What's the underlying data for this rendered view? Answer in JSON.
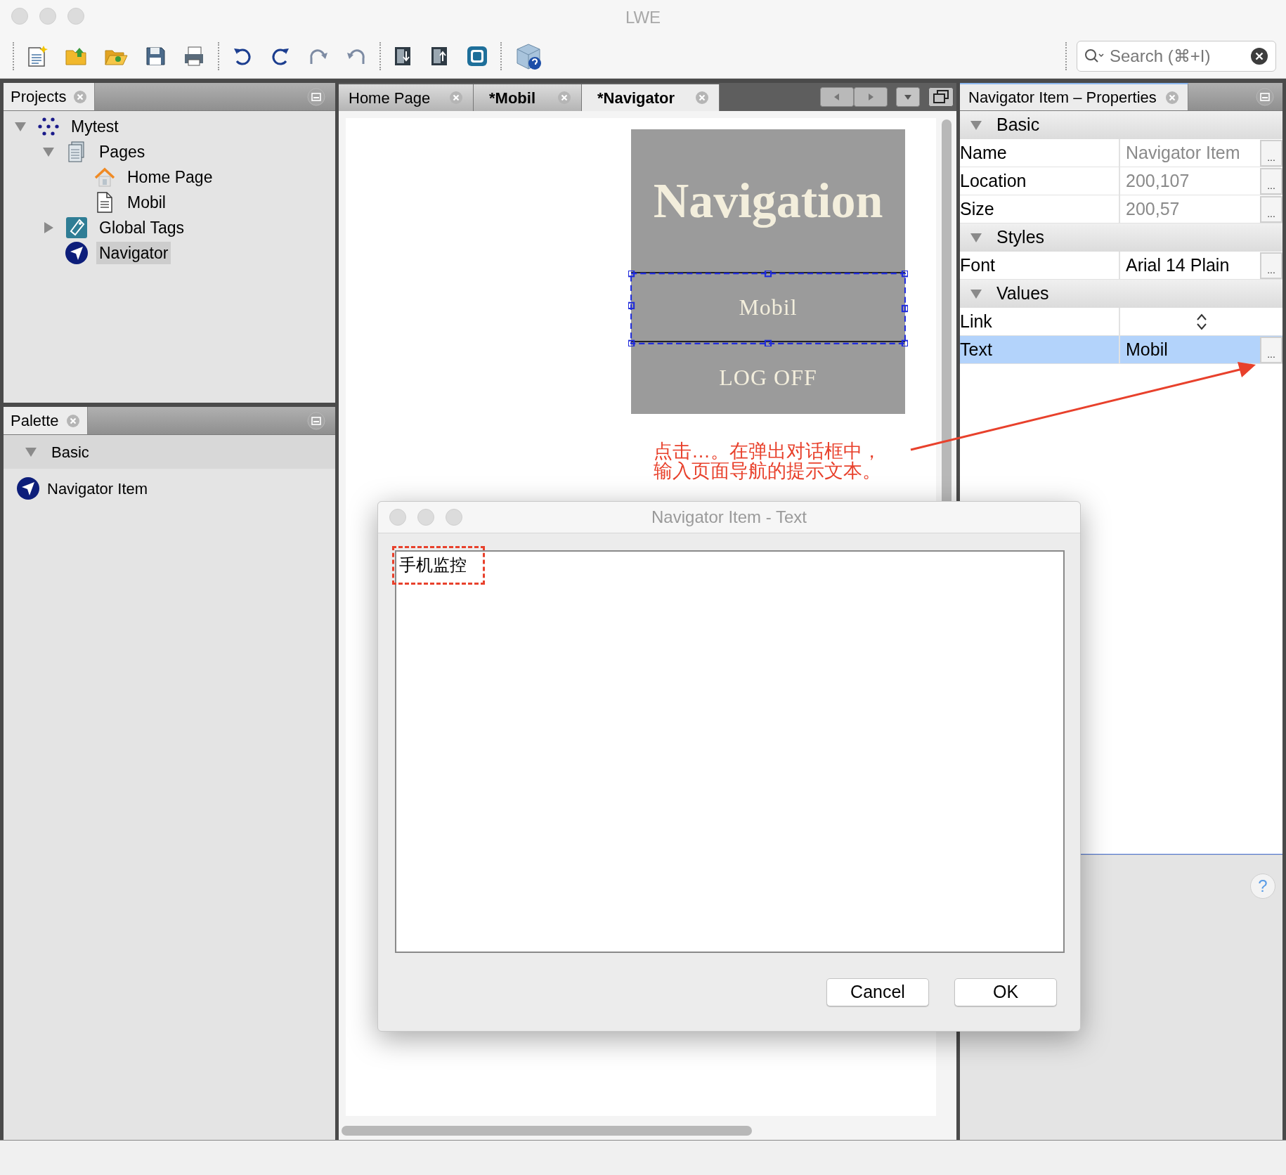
{
  "window": {
    "title": "LWE"
  },
  "toolbar": {
    "search": {
      "placeholder": "Search (⌘+I)"
    }
  },
  "projects_panel": {
    "title": "Projects",
    "tree": [
      {
        "label": "Mytest",
        "kind": "project",
        "expanded": true,
        "selected": false,
        "children": [
          {
            "label": "Pages",
            "kind": "pages",
            "expanded": true,
            "selected": false,
            "children": [
              {
                "label": "Home Page",
                "kind": "home",
                "selected": false
              },
              {
                "label": "Mobil",
                "kind": "page",
                "selected": false
              }
            ]
          },
          {
            "label": "Global Tags",
            "kind": "tags",
            "expanded": false,
            "selected": false
          },
          {
            "label": "Navigator",
            "kind": "navigator",
            "selected": true
          }
        ]
      }
    ]
  },
  "palette": {
    "title": "Palette",
    "groups": [
      {
        "label": "Basic",
        "expanded": true,
        "items": [
          {
            "label": "Navigator Item",
            "kind": "navigator"
          }
        ]
      }
    ]
  },
  "editor": {
    "tabs": [
      {
        "label": "Home Page",
        "selected": false,
        "modified": false
      },
      {
        "label": "*Mobil",
        "selected": false,
        "modified": true
      },
      {
        "label": "*Navigator",
        "selected": true,
        "modified": true
      }
    ],
    "navigator": {
      "title": "Navigation",
      "items": [
        {
          "label": "Mobil",
          "selected": true
        },
        {
          "label": "LOG OFF",
          "selected": false
        }
      ]
    }
  },
  "annotation": {
    "lines": [
      "点击…。在弹出对话框中，",
      "输入页面导航的提示文本。"
    ]
  },
  "properties": {
    "title": "Navigator Item – Properties",
    "sections": [
      {
        "label": "Basic",
        "expanded": true,
        "rows": [
          {
            "name": "Name",
            "value": "Navigator Item",
            "kind": "dialog",
            "button": "...",
            "disabled": true,
            "selected": false
          },
          {
            "name": "Location",
            "value": "200,107",
            "kind": "dialog",
            "button": "...",
            "disabled": true,
            "selected": false
          },
          {
            "name": "Size",
            "value": "200,57",
            "kind": "dialog",
            "button": "...",
            "disabled": true,
            "selected": false
          }
        ]
      },
      {
        "label": "Styles",
        "expanded": true,
        "rows": [
          {
            "name": "Font",
            "value": "Arial 14 Plain",
            "kind": "dialog",
            "button": "...",
            "disabled": false,
            "selected": false
          }
        ]
      },
      {
        "label": "Values",
        "expanded": true,
        "rows": [
          {
            "name": "Link",
            "kind": "choice",
            "selected": false
          },
          {
            "name": "Text",
            "value": "Mobil",
            "kind": "dialog",
            "button": "...",
            "disabled": false,
            "selected": true
          }
        ]
      }
    ],
    "help_button": "?"
  },
  "dialog": {
    "title": "Navigator Item - Text",
    "value": "手机监控",
    "buttons": [
      "Cancel",
      "OK"
    ]
  }
}
